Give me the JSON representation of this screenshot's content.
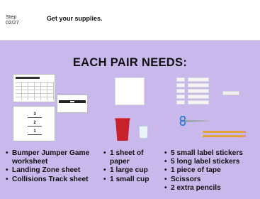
{
  "header": {
    "step_label": "Step",
    "step_count": "02/27",
    "title": "Get your supplies."
  },
  "slide": {
    "title": "EACH PAIR NEEDS:",
    "background": "#c9b8ec",
    "columns": [
      {
        "items": [
          "Bumper Jumper Game worksheet",
          "Landing Zone sheet",
          "Collisions Track sheet"
        ]
      },
      {
        "items": [
          "1 sheet of paper",
          "1 large cup",
          "1 small cup"
        ]
      },
      {
        "items": [
          "5 small label stickers",
          "5 long label stickers",
          "1 piece of tape",
          "Scissors",
          "2 extra pencils"
        ]
      }
    ],
    "zone_numbers": [
      "3",
      "2",
      "1"
    ],
    "colors": {
      "large_cup": "#c7222b",
      "scissors": "#3b7fd0",
      "pencil": "#e3a13d"
    }
  }
}
